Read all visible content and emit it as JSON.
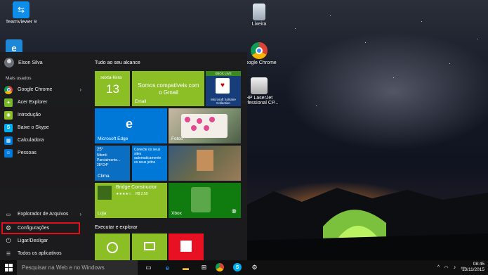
{
  "desktop": {
    "icons": [
      {
        "label": "TeamViewer 9"
      },
      {
        "label": "Lixeira"
      },
      {
        "label": "Google Chrome"
      },
      {
        "label": "HP LaserJet Professional CP..."
      }
    ]
  },
  "start_menu": {
    "user_name": "Elson Silva",
    "most_used_label": "Mais usados",
    "apps": [
      {
        "label": "Google Chrome",
        "icon": "chrome-icon",
        "color": "#e8e8e8",
        "has_chevron": true
      },
      {
        "label": "Acer Explorer",
        "icon": "acer-icon",
        "color": "#78b82a",
        "has_chevron": false
      },
      {
        "label": "Introdução",
        "icon": "lightbulb-icon",
        "color": "#0078d7",
        "has_chevron": false
      },
      {
        "label": "Baixe o Skype",
        "icon": "skype-icon",
        "color": "#00aff0",
        "has_chevron": false
      },
      {
        "label": "Calculadora",
        "icon": "calculator-icon",
        "color": "#0078d7",
        "has_chevron": false
      },
      {
        "label": "Pessoas",
        "icon": "people-icon",
        "color": "#0078d7",
        "has_chevron": false
      }
    ],
    "bottom_items": [
      {
        "label": "Explorador de Arquivos",
        "icon": "folder-icon"
      },
      {
        "label": "Configurações",
        "icon": "gear-icon"
      },
      {
        "label": "Ligar/Desligar",
        "icon": "power-icon"
      },
      {
        "label": "Todos os aplicativos",
        "icon": "list-icon"
      }
    ],
    "tile_group_1": "Tudo ao seu alcance",
    "tile_group_2": "Executar e explorar",
    "tiles": {
      "calendar": {
        "day": "sexta-feira",
        "date": "13"
      },
      "mail": {
        "text": "Somos compatíveis com o Gmail",
        "name": "Email"
      },
      "solitaire": {
        "badge": "XBOX LIVE",
        "name": "Microsoft Solitaire Collection"
      },
      "edge": {
        "name": "Microsoft Edge"
      },
      "photos": {
        "name": "Fotos"
      },
      "weather": {
        "temp": "25°",
        "place": "Niterói",
        "desc": "Parcialmente...",
        "range": "28°/24°",
        "name": "Clima"
      },
      "connect": {
        "text": "Conecte os seus sites automaticamente os seus jeitos"
      },
      "minecraft": {},
      "store": {
        "title": "Bridge Constructor",
        "stars": "★★★★☆",
        "price": "R$ 2.50",
        "name": "Loja"
      },
      "xbox": {
        "name": "Xbox"
      }
    }
  },
  "taskbar": {
    "search_placeholder": "Pesquisar na Web e no Windows",
    "time": "08:45",
    "date": "13/11/2015"
  },
  "colors": {
    "accent_green": "#8cbf26",
    "accent_blue": "#0078d7",
    "highlight_red": "#e0101a"
  }
}
